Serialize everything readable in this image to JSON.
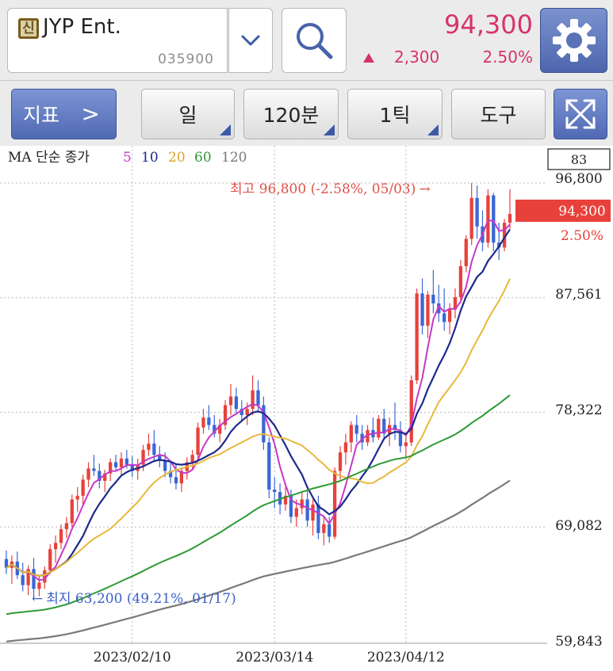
{
  "header": {
    "badge": "신",
    "name": "JYP Ent.",
    "code": "035900",
    "price": "94,300",
    "change_abs": "2,300",
    "change_pct": "2.50%",
    "change_direction": "up"
  },
  "toolbar": {
    "indicator": "지표",
    "indicator_arrow": ">",
    "period": "일",
    "minute": "120분",
    "tick": "1틱",
    "tools": "도구"
  },
  "colors": {
    "up": "#e8413b",
    "down": "#3a67d6",
    "ma5": "#c638c6",
    "ma10": "#1c2a8c",
    "ma20": "#e8b83a",
    "ma60": "#2e9a36",
    "ma120": "#7a7a7a",
    "accent": "#5069b4"
  },
  "chart_data": {
    "type": "candlestick",
    "legend": {
      "prefix": "MA 단순 종가",
      "periods": [
        "5",
        "10",
        "20",
        "60",
        "120"
      ]
    },
    "yticks": [
      96800,
      87561,
      78322,
      69082,
      59843
    ],
    "ytick_labels": [
      "96,800",
      "87,561",
      "78,322",
      "69,082",
      "59,843"
    ],
    "xticks": [
      "2023/02/10",
      "2023/03/14",
      "2023/04/12"
    ],
    "ylim": [
      59843,
      96800
    ],
    "cursor_label": "83",
    "last_price_label": "94,300",
    "last_change_label": "2.50%",
    "high_label": "최고 96,800 (-2.58%, 05/03)",
    "low_label": "최지 63,200 (49.21%, 01/17)",
    "candles": [
      [
        66500,
        67200,
        65300,
        65800
      ],
      [
        65800,
        66800,
        64500,
        66300
      ],
      [
        66300,
        67100,
        64900,
        65200
      ],
      [
        65200,
        66200,
        63900,
        64400
      ],
      [
        64400,
        66000,
        63600,
        65700
      ],
      [
        65700,
        66600,
        63200,
        64100
      ],
      [
        64100,
        65100,
        63500,
        64600
      ],
      [
        64600,
        65900,
        64100,
        65600
      ],
      [
        65600,
        67700,
        65300,
        67300
      ],
      [
        67300,
        68400,
        66200,
        67800
      ],
      [
        67800,
        69300,
        67300,
        68900
      ],
      [
        68900,
        69900,
        68200,
        69400
      ],
      [
        69400,
        71700,
        69100,
        71300
      ],
      [
        71300,
        72300,
        70300,
        71600
      ],
      [
        71600,
        73300,
        70900,
        72900
      ],
      [
        72900,
        74300,
        72300,
        73800
      ],
      [
        73800,
        74900,
        73200,
        73600
      ],
      [
        73600,
        74200,
        72200,
        72800
      ],
      [
        72800,
        73700,
        71900,
        73400
      ],
      [
        73400,
        74600,
        72800,
        74300
      ],
      [
        74300,
        74900,
        73600,
        73900
      ],
      [
        73900,
        75100,
        73300,
        74600
      ],
      [
        74600,
        75300,
        73800,
        74100
      ],
      [
        74100,
        74800,
        73100,
        73600
      ],
      [
        73600,
        74600,
        72900,
        74100
      ],
      [
        74100,
        75700,
        73600,
        75300
      ],
      [
        75300,
        76600,
        74800,
        75800
      ],
      [
        75800,
        76900,
        74300,
        74900
      ],
      [
        74900,
        75600,
        73900,
        74400
      ],
      [
        74400,
        75100,
        73100,
        73600
      ],
      [
        73600,
        74400,
        72600,
        73100
      ],
      [
        73100,
        74100,
        72100,
        72600
      ],
      [
        72600,
        73900,
        71900,
        73600
      ],
      [
        73600,
        74700,
        72900,
        74300
      ],
      [
        74300,
        75300,
        73700,
        74900
      ],
      [
        74900,
        77500,
        74600,
        77100
      ],
      [
        77100,
        78600,
        76600,
        77900
      ],
      [
        77900,
        78900,
        76900,
        77300
      ],
      [
        77300,
        78100,
        76300,
        76600
      ],
      [
        76600,
        77800,
        75900,
        77300
      ],
      [
        77300,
        79300,
        76900,
        78900
      ],
      [
        78900,
        80600,
        78100,
        79600
      ],
      [
        79600,
        80300,
        78300,
        78600
      ],
      [
        78600,
        79300,
        77600,
        78100
      ],
      [
        78100,
        79100,
        77300,
        78600
      ],
      [
        78600,
        81300,
        78100,
        80100
      ],
      [
        80100,
        80900,
        78300,
        78900
      ],
      [
        78900,
        79600,
        75300,
        75900
      ],
      [
        75900,
        76300,
        71400,
        72100
      ],
      [
        72100,
        73100,
        70600,
        71900
      ],
      [
        71900,
        72600,
        70100,
        70900
      ],
      [
        70900,
        72300,
        70400,
        71600
      ],
      [
        71600,
        72100,
        69400,
        69900
      ],
      [
        69900,
        71300,
        69100,
        70600
      ],
      [
        70600,
        71900,
        70100,
        71300
      ],
      [
        71300,
        72100,
        69100,
        69600
      ],
      [
        69600,
        71300,
        68400,
        70900
      ],
      [
        70900,
        71600,
        68100,
        68600
      ],
      [
        68600,
        69900,
        67600,
        69300
      ],
      [
        69300,
        69900,
        67800,
        68300
      ],
      [
        68300,
        73900,
        68100,
        73600
      ],
      [
        73600,
        75600,
        72900,
        75100
      ],
      [
        75100,
        76600,
        74100,
        75900
      ],
      [
        75900,
        77600,
        75100,
        77300
      ],
      [
        77300,
        78100,
        75900,
        76600
      ],
      [
        76600,
        77300,
        75300,
        75900
      ],
      [
        75900,
        77300,
        75600,
        76900
      ],
      [
        76900,
        77900,
        75900,
        76300
      ],
      [
        76300,
        78100,
        76100,
        77800
      ],
      [
        77800,
        78600,
        76100,
        76600
      ],
      [
        76600,
        77900,
        75600,
        77300
      ],
      [
        77300,
        79100,
        76100,
        76900
      ],
      [
        76900,
        77600,
        75100,
        75600
      ],
      [
        75600,
        76600,
        74600,
        75900
      ],
      [
        75900,
        81300,
        75600,
        80900
      ],
      [
        80900,
        88300,
        80600,
        87900
      ],
      [
        87900,
        89100,
        84600,
        85300
      ],
      [
        85300,
        88100,
        84300,
        87800
      ],
      [
        87800,
        89800,
        86300,
        87100
      ],
      [
        87100,
        88600,
        85600,
        86300
      ],
      [
        86300,
        88300,
        84900,
        85600
      ],
      [
        85600,
        87100,
        84600,
        86600
      ],
      [
        86600,
        88300,
        85900,
        87600
      ],
      [
        87600,
        90600,
        87300,
        90100
      ],
      [
        90100,
        92600,
        89600,
        92300
      ],
      [
        92300,
        96800,
        91800,
        95600
      ],
      [
        95600,
        96600,
        92300,
        93300
      ],
      [
        93300,
        94600,
        91300,
        92000
      ],
      [
        92000,
        96300,
        91600,
        95800
      ],
      [
        95800,
        96000,
        91300,
        92000
      ],
      [
        92000,
        93600,
        90600,
        91600
      ],
      [
        91600,
        93900,
        91300,
        93600
      ],
      [
        93600,
        96300,
        93100,
        94300
      ]
    ]
  }
}
